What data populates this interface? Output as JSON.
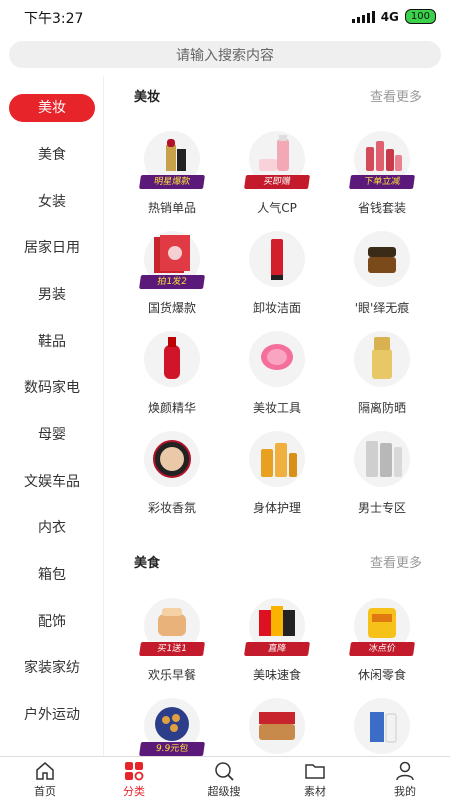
{
  "status": {
    "time": "下午3:27",
    "network": "4G",
    "battery": "100"
  },
  "search": {
    "placeholder": "请输入搜索内容"
  },
  "sidebar": {
    "items": [
      {
        "label": "美妆"
      },
      {
        "label": "美食"
      },
      {
        "label": "女装"
      },
      {
        "label": "居家日用"
      },
      {
        "label": "男装"
      },
      {
        "label": "鞋品"
      },
      {
        "label": "数码家电"
      },
      {
        "label": "母婴"
      },
      {
        "label": "文娱车品"
      },
      {
        "label": "内衣"
      },
      {
        "label": "箱包"
      },
      {
        "label": "配饰"
      },
      {
        "label": "家装家纺"
      },
      {
        "label": "户外运动"
      }
    ]
  },
  "sections": [
    {
      "title": "美妆",
      "more": "查看更多",
      "items": [
        {
          "label": "热销单品",
          "badge": "明星爆款",
          "icon": "lipstick-icon"
        },
        {
          "label": "人气CP",
          "badge": "买即赠",
          "icon": "skincare-set-icon"
        },
        {
          "label": "省钱套装",
          "badge": "下单立减",
          "icon": "bottle-set-icon"
        },
        {
          "label": "国货爆款",
          "badge": "拍1发2",
          "icon": "face-mask-icon"
        },
        {
          "label": "卸妆洁面",
          "badge": "",
          "icon": "cleanser-tube-icon"
        },
        {
          "label": "'眼'绎无痕",
          "badge": "",
          "icon": "eye-cream-jar-icon"
        },
        {
          "label": "焕颜精华",
          "badge": "",
          "icon": "serum-bottle-icon"
        },
        {
          "label": "美妆工具",
          "badge": "",
          "icon": "face-brush-icon"
        },
        {
          "label": "隔离防晒",
          "badge": "",
          "icon": "sunscreen-icon"
        },
        {
          "label": "彩妆香氛",
          "badge": "",
          "icon": "cushion-compact-icon"
        },
        {
          "label": "身体护理",
          "badge": "",
          "icon": "body-oil-icon"
        },
        {
          "label": "男士专区",
          "badge": "",
          "icon": "mens-bottles-icon"
        }
      ]
    },
    {
      "title": "美食",
      "more": "查看更多",
      "items": [
        {
          "label": "欢乐早餐",
          "badge": "买1送1",
          "icon": "bread-icon"
        },
        {
          "label": "美味速食",
          "badge": "直降",
          "icon": "snack-bags-icon"
        },
        {
          "label": "休闲零食",
          "badge": "冰点价",
          "icon": "chips-bag-icon"
        },
        {
          "label": "",
          "badge": "9.9元包",
          "icon": "cookies-tin-icon"
        },
        {
          "label": "",
          "badge": "",
          "icon": "nuts-gift-box-icon"
        },
        {
          "label": "",
          "badge": "",
          "icon": "milk-box-icon"
        }
      ]
    }
  ],
  "tabbar": {
    "items": [
      {
        "label": "首页",
        "icon": "home-icon"
      },
      {
        "label": "分类",
        "icon": "category-icon"
      },
      {
        "label": "超级搜",
        "icon": "search-icon"
      },
      {
        "label": "素材",
        "icon": "folder-icon"
      },
      {
        "label": "我的",
        "icon": "user-icon"
      }
    ]
  },
  "colors": {
    "accent": "#e8242b",
    "badge_purple": "#5b1a7a",
    "badge_red": "#c31b2b"
  }
}
